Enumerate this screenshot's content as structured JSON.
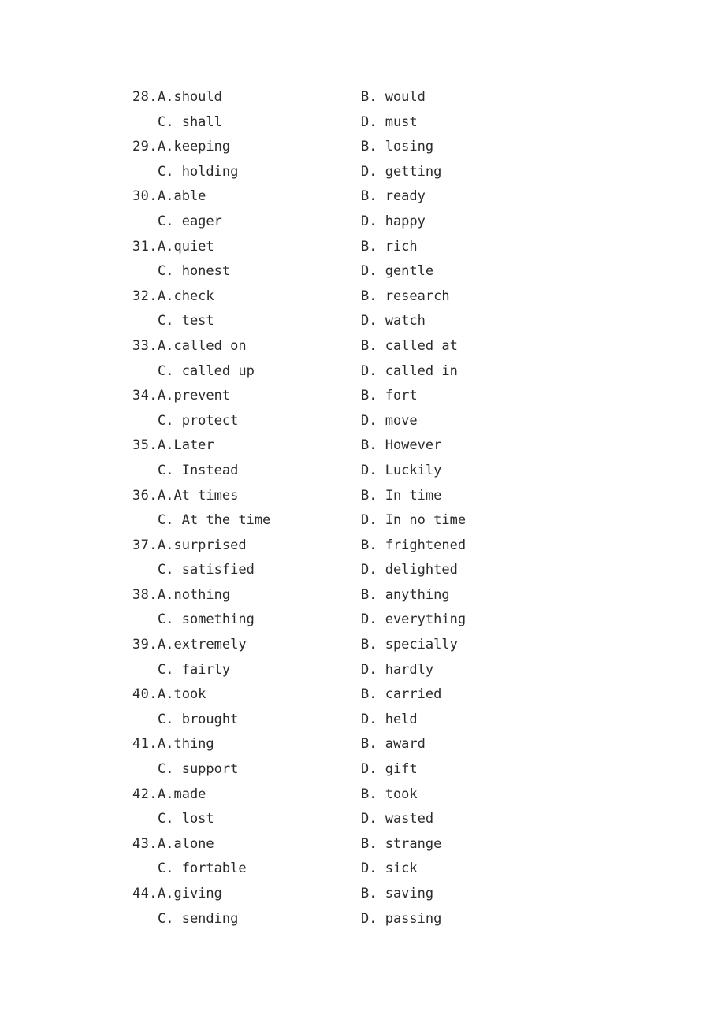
{
  "document": {
    "type": "exam-answer-options-page",
    "background_color": "#ffffff",
    "text_color": "#2a2a2a",
    "label_a": "A.",
    "label_b": "B.",
    "label_c": "C.",
    "label_d": "D.",
    "number_suffix": "."
  },
  "questions": [
    {
      "number": "28.",
      "a": "A.should",
      "b": "B. would",
      "c": "C. shall",
      "d": "D. must"
    },
    {
      "number": "29.",
      "a": "A.keeping",
      "b": "B. losing",
      "c": "C. holding",
      "d": "D. getting"
    },
    {
      "number": "30.",
      "a": "A.able",
      "b": "B. ready",
      "c": "C. eager",
      "d": "D. happy"
    },
    {
      "number": "31.",
      "a": "A.quiet",
      "b": "B. rich",
      "c": "C. honest",
      "d": "D. gentle"
    },
    {
      "number": "32.",
      "a": "A.check",
      "b": "B. research",
      "c": "C. test",
      "d": "D. watch"
    },
    {
      "number": "33.",
      "a": "A.called on",
      "b": "B. called at",
      "c": "C. called up",
      "d": "D. called in"
    },
    {
      "number": "34.",
      "a": "A.prevent",
      "b": "B. fort",
      "c": "C. protect",
      "d": "D. move"
    },
    {
      "number": "35.",
      "a": "A.Later",
      "b": "B. However",
      "c": "C. Instead",
      "d": "D. Luckily"
    },
    {
      "number": "36.",
      "a": "A.At times",
      "b": "B. In time",
      "c": "C. At the time",
      "d": "D. In no time"
    },
    {
      "number": "37.",
      "a": "A.surprised",
      "b": "B. frightened",
      "c": "C. satisfied",
      "d": "D. delighted"
    },
    {
      "number": "38.",
      "a": "A.nothing",
      "b": "B. anything",
      "c": "C. something",
      "d": "D. everything"
    },
    {
      "number": "39.",
      "a": "A.extremely",
      "b": "B. specially",
      "c": "C. fairly",
      "d": "D. hardly"
    },
    {
      "number": "40.",
      "a": "A.took",
      "b": "B. carried",
      "c": "C. brought",
      "d": "D. held"
    },
    {
      "number": "41.",
      "a": "A.thing",
      "b": "B. award",
      "c": "C. support",
      "d": "D. gift"
    },
    {
      "number": "42.",
      "a": "A.made",
      "b": "B. took",
      "c": "C. lost",
      "d": "D. wasted"
    },
    {
      "number": "43.",
      "a": "A.alone",
      "b": "B. strange",
      "c": "C. fortable",
      "d": "D. sick"
    },
    {
      "number": "44.",
      "a": "A.giving",
      "b": "B. saving",
      "c": "C. sending",
      "d": "D. passing"
    }
  ]
}
